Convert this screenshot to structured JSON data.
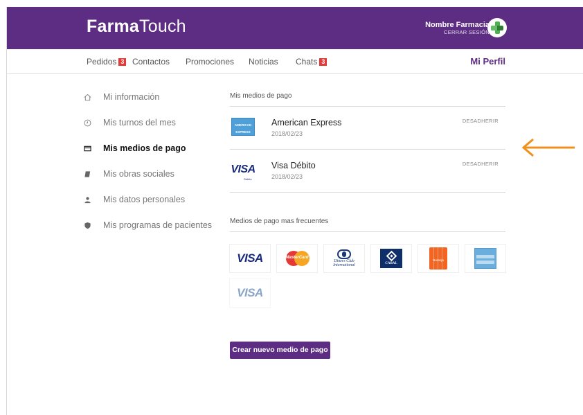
{
  "header": {
    "brand_bold": "Farma",
    "brand_light": "Touch",
    "pharmacy_name": "Nombre Farmacia",
    "logout_label": "CERRAR SESIÓN"
  },
  "nav": {
    "items": [
      {
        "label": "Pedidos",
        "badge": "3"
      },
      {
        "label": "Contactos"
      },
      {
        "label": "Promociones"
      },
      {
        "label": "Noticias"
      },
      {
        "label": "Chats",
        "badge": "3"
      }
    ],
    "profile_label": "Mi Perfil"
  },
  "sidebar": {
    "items": [
      {
        "label": "Mi información",
        "icon": "home-icon"
      },
      {
        "label": "Mis turnos del mes",
        "icon": "clock-icon"
      },
      {
        "label": "Mis medios de pago",
        "icon": "credit-card-icon",
        "active": true
      },
      {
        "label": "Mis obras sociales",
        "icon": "book-icon"
      },
      {
        "label": "Mis datos personales",
        "icon": "person-icon"
      },
      {
        "label": "Mis programas de pacientes",
        "icon": "shield-icon"
      }
    ]
  },
  "payment_methods": {
    "title": "Mis medios de pago",
    "items": [
      {
        "name": "American Express",
        "date": "2018/02/23",
        "action": "DESADHERIR",
        "logo": "amex-logo"
      },
      {
        "name": "Visa Débito",
        "date": "2018/02/23",
        "action": "DESADHERIR",
        "logo": "visa-debit-logo"
      }
    ]
  },
  "frequent": {
    "title": "Medios de pago mas frecuentes",
    "cards": [
      {
        "name": "VISA",
        "logo": "visa-logo"
      },
      {
        "name": "MasterCard",
        "logo": "mastercard-logo"
      },
      {
        "name": "Diners Club International",
        "logo": "diners-logo"
      },
      {
        "name": "CABAL",
        "logo": "cabal-logo"
      },
      {
        "name": "Naranja",
        "logo": "naranja-logo"
      },
      {
        "name": "American Express",
        "logo": "amex-logo"
      },
      {
        "name": "VISA",
        "logo": "visa-debit-logo"
      }
    ]
  },
  "actions": {
    "create_label": "Crear nuevo medio de pago"
  },
  "colors": {
    "brand": "#5c2d82",
    "badge": "#e53935",
    "annotation_arrow": "#f0901e"
  }
}
